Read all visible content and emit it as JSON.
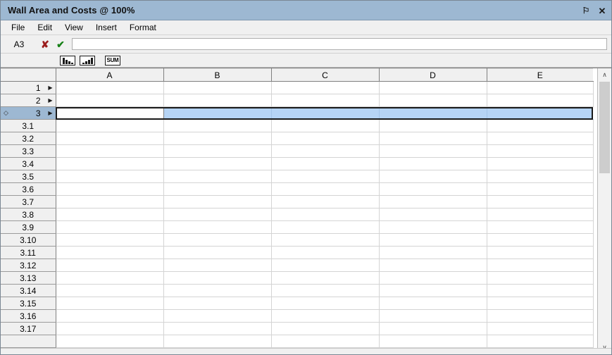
{
  "window": {
    "title": "Wall Area and Costs @ 100%",
    "pin_icon": "pin-icon",
    "close_icon": "close-icon",
    "pin_glyph": "⚐",
    "close_glyph": "✕"
  },
  "menubar": {
    "items": [
      {
        "label": "File"
      },
      {
        "label": "Edit"
      },
      {
        "label": "View"
      },
      {
        "label": "Insert"
      },
      {
        "label": "Format"
      }
    ]
  },
  "formula_bar": {
    "cell_reference": "A3",
    "cancel_icon": "cancel-icon",
    "cancel_glyph": "✘",
    "accept_icon": "accept-icon",
    "accept_glyph": "✔",
    "input_value": "",
    "input_placeholder": ""
  },
  "toolbar": {
    "buttons": [
      {
        "name": "bar-chart-descending-icon",
        "label": ""
      },
      {
        "name": "bar-chart-ascending-icon",
        "label": ""
      },
      {
        "name": "sum-button",
        "label": "SUM"
      }
    ]
  },
  "sheet": {
    "columns": [
      "A",
      "B",
      "C",
      "D",
      "E"
    ],
    "rows": [
      {
        "label": "1",
        "diamond": "",
        "arrow": "▶",
        "selected": false
      },
      {
        "label": "2",
        "diamond": "",
        "arrow": "▶",
        "selected": false
      },
      {
        "label": "3",
        "diamond": "◇",
        "arrow": "▶",
        "selected": true
      },
      {
        "label": "3.1",
        "diamond": "",
        "arrow": "",
        "selected": false
      },
      {
        "label": "3.2",
        "diamond": "",
        "arrow": "",
        "selected": false
      },
      {
        "label": "3.3",
        "diamond": "",
        "arrow": "",
        "selected": false
      },
      {
        "label": "3.4",
        "diamond": "",
        "arrow": "",
        "selected": false
      },
      {
        "label": "3.5",
        "diamond": "",
        "arrow": "",
        "selected": false
      },
      {
        "label": "3.6",
        "diamond": "",
        "arrow": "",
        "selected": false
      },
      {
        "label": "3.7",
        "diamond": "",
        "arrow": "",
        "selected": false
      },
      {
        "label": "3.8",
        "diamond": "",
        "arrow": "",
        "selected": false
      },
      {
        "label": "3.9",
        "diamond": "",
        "arrow": "",
        "selected": false
      },
      {
        "label": "3.10",
        "diamond": "",
        "arrow": "",
        "selected": false
      },
      {
        "label": "3.11",
        "diamond": "",
        "arrow": "",
        "selected": false
      },
      {
        "label": "3.12",
        "diamond": "",
        "arrow": "",
        "selected": false
      },
      {
        "label": "3.13",
        "diamond": "",
        "arrow": "",
        "selected": false
      },
      {
        "label": "3.14",
        "diamond": "",
        "arrow": "",
        "selected": false
      },
      {
        "label": "3.15",
        "diamond": "",
        "arrow": "",
        "selected": false
      },
      {
        "label": "3.16",
        "diamond": "",
        "arrow": "",
        "selected": false
      },
      {
        "label": "3.17",
        "diamond": "",
        "arrow": "",
        "selected": false
      },
      {
        "label": "",
        "diamond": "",
        "arrow": "",
        "selected": false
      }
    ],
    "cell_values": {},
    "active_cell": "A3",
    "selected_row_label": "3"
  },
  "scrollbar": {
    "up_icon": "chevron-up-icon",
    "down_icon": "chevron-down-icon",
    "up_glyph": "∧",
    "down_glyph": "∨"
  },
  "colors": {
    "titlebar": "#9db8d2",
    "selection_fill": "#b6d4f5",
    "header_bg": "#f0f0f0",
    "accept": "#168016",
    "cancel": "#9b1c1c"
  }
}
